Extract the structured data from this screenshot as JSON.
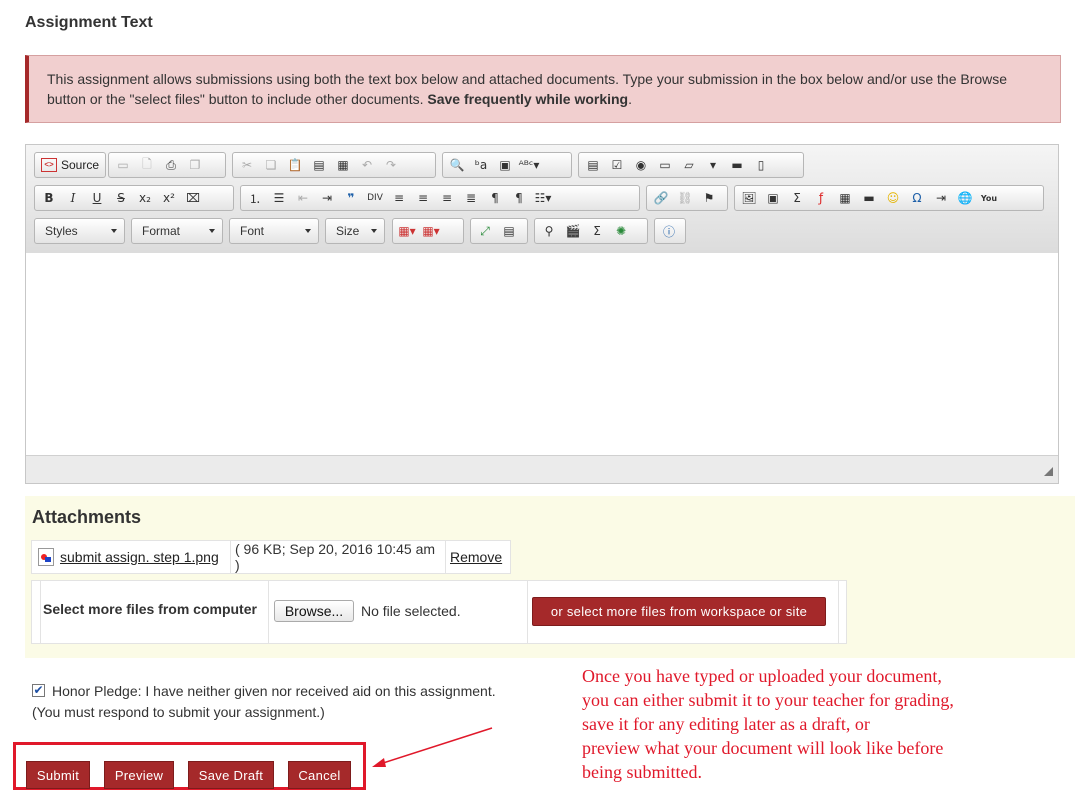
{
  "section_title": "Assignment Text",
  "notice": {
    "text": "This assignment allows submissions using both the text box below and attached documents. Type your submission in the box below and/or use the Browse button or the \"select files\" button to include other documents.",
    "bold": "Save frequently while working",
    "end": "."
  },
  "editor": {
    "source_label": "Source",
    "styles_label": "Styles",
    "format_label": "Format",
    "font_label": "Font",
    "size_label": "Size",
    "content": ""
  },
  "attachments": {
    "title": "Attachments",
    "file_name": "submit assign. step 1.png",
    "file_meta": "( 96 KB; Sep 20, 2016 10:45 am )",
    "remove_label": "Remove",
    "select_label": "Select more files from computer",
    "browse_label": "Browse...",
    "no_file": "No file selected.",
    "workspace_label": "or select more files from workspace or site"
  },
  "honor": {
    "checked": true,
    "line1": "Honor Pledge: I have neither given nor received aid on this assignment.",
    "line2": "(You must respond to submit your assignment.)"
  },
  "actions": {
    "submit": "Submit",
    "preview": "Preview",
    "save_draft": "Save Draft",
    "cancel": "Cancel"
  },
  "annotation": {
    "line1": "Once you have typed or uploaded your document,",
    "line2": "you can either submit it to your teacher for grading,",
    "line3": "save it for any editing later as a draft, or",
    "line4": "preview what your document will look like before",
    "line5": "being submitted."
  },
  "colors": {
    "accent": "#a5292a",
    "notice_bg": "#f1cfcf",
    "attachments_bg": "#fbfbe6",
    "annotation": "#e0182a"
  }
}
